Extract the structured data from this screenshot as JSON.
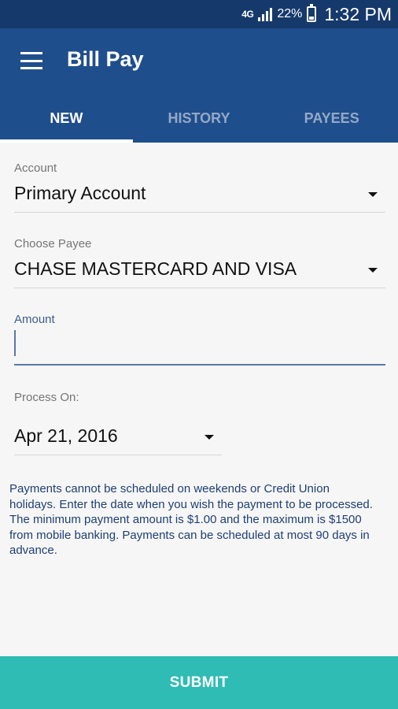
{
  "status_bar": {
    "network": "4G",
    "battery_percent": "22%",
    "time": "1:32 PM"
  },
  "app_bar": {
    "title": "Bill Pay",
    "menu_icon": "hamburger-menu-icon"
  },
  "tabs": [
    {
      "label": "NEW",
      "active": true
    },
    {
      "label": "HISTORY",
      "active": false
    },
    {
      "label": "PAYEES",
      "active": false
    }
  ],
  "form": {
    "account": {
      "label": "Account",
      "value": "Primary Account"
    },
    "payee": {
      "label": "Choose Payee",
      "value": "CHASE MASTERCARD AND VISA"
    },
    "amount": {
      "label": "Amount",
      "value": ""
    },
    "process_on": {
      "label": "Process On:",
      "value": "Apr 21, 2016"
    }
  },
  "info_text": "Payments cannot be scheduled on weekends or Credit Union holidays. Enter the date when you wish the payment to be processed. The minimum payment amount is $1.00 and the maximum is $1500 from mobile banking. Payments can be scheduled at most 90 days in advance.",
  "submit": {
    "label": "SUBMIT"
  },
  "colors": {
    "status_bar": "#16396b",
    "app_bar": "#1f4e8c",
    "submit": "#2ebcb4"
  }
}
